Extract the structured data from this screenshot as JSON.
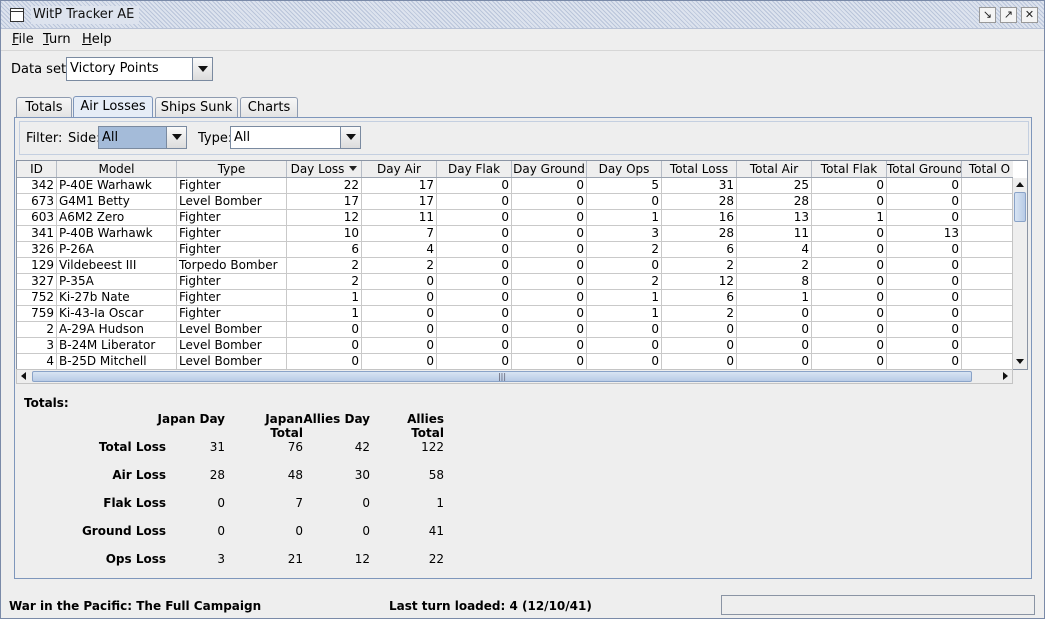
{
  "window": {
    "title": "WitP Tracker AE"
  },
  "menu": [
    {
      "label": "File",
      "mnemonic": "F",
      "rest": "ile"
    },
    {
      "label": "Turn",
      "mnemonic": "T",
      "rest": "urn"
    },
    {
      "label": "Help",
      "mnemonic": "H",
      "rest": "elp"
    }
  ],
  "dataset": {
    "label": "Data set:",
    "value": "Victory Points"
  },
  "tabs": [
    "Totals",
    "Air Losses",
    "Ships Sunk",
    "Charts"
  ],
  "active_tab": "Air Losses",
  "filter": {
    "label": "Filter:",
    "side_label": "Side:",
    "side_value": "All",
    "type_label": "Type:",
    "type_value": "All"
  },
  "table": {
    "columns": [
      "ID",
      "Model",
      "Type",
      "Day Loss",
      "Day Air",
      "Day Flak",
      "Day Ground",
      "Day Ops",
      "Total Loss",
      "Total Air",
      "Total Flak",
      "Total Ground",
      "Total O"
    ],
    "sorted_column": "Day Loss",
    "rows": [
      [
        "342",
        "P-40E Warhawk",
        "Fighter",
        "22",
        "17",
        "0",
        "0",
        "5",
        "31",
        "25",
        "0",
        "0",
        ""
      ],
      [
        "673",
        "G4M1 Betty",
        "Level Bomber",
        "17",
        "17",
        "0",
        "0",
        "0",
        "28",
        "28",
        "0",
        "0",
        ""
      ],
      [
        "603",
        "A6M2 Zero",
        "Fighter",
        "12",
        "11",
        "0",
        "0",
        "1",
        "16",
        "13",
        "1",
        "0",
        ""
      ],
      [
        "341",
        "P-40B Warhawk",
        "Fighter",
        "10",
        "7",
        "0",
        "0",
        "3",
        "28",
        "11",
        "0",
        "13",
        ""
      ],
      [
        "326",
        "P-26A",
        "Fighter",
        "6",
        "4",
        "0",
        "0",
        "2",
        "6",
        "4",
        "0",
        "0",
        ""
      ],
      [
        "129",
        "Vildebeest III",
        "Torpedo Bomber",
        "2",
        "2",
        "0",
        "0",
        "0",
        "2",
        "2",
        "0",
        "0",
        ""
      ],
      [
        "327",
        "P-35A",
        "Fighter",
        "2",
        "0",
        "0",
        "0",
        "2",
        "12",
        "8",
        "0",
        "0",
        ""
      ],
      [
        "752",
        "Ki-27b Nate",
        "Fighter",
        "1",
        "0",
        "0",
        "0",
        "1",
        "6",
        "1",
        "0",
        "0",
        ""
      ],
      [
        "759",
        "Ki-43-Ia Oscar",
        "Fighter",
        "1",
        "0",
        "0",
        "0",
        "1",
        "2",
        "0",
        "0",
        "0",
        ""
      ],
      [
        "2",
        "A-29A Hudson",
        "Level Bomber",
        "0",
        "0",
        "0",
        "0",
        "0",
        "0",
        "0",
        "0",
        "0",
        ""
      ],
      [
        "3",
        "B-24M Liberator",
        "Level Bomber",
        "0",
        "0",
        "0",
        "0",
        "0",
        "0",
        "0",
        "0",
        "0",
        ""
      ],
      [
        "4",
        "B-25D Mitchell",
        "Level Bomber",
        "0",
        "0",
        "0",
        "0",
        "0",
        "0",
        "0",
        "0",
        "0",
        ""
      ]
    ]
  },
  "totals": {
    "title": "Totals:",
    "columns": [
      "Japan Day",
      "Japan Total",
      "Allies Day",
      "Allies Total"
    ],
    "rows": [
      {
        "label": "Total Loss",
        "values": [
          "31",
          "76",
          "42",
          "122"
        ]
      },
      {
        "label": "Air Loss",
        "values": [
          "28",
          "48",
          "30",
          "58"
        ]
      },
      {
        "label": "Flak Loss",
        "values": [
          "0",
          "7",
          "0",
          "1"
        ]
      },
      {
        "label": "Ground Loss",
        "values": [
          "0",
          "0",
          "0",
          "41"
        ]
      },
      {
        "label": "Ops Loss",
        "values": [
          "3",
          "21",
          "12",
          "22"
        ]
      }
    ]
  },
  "status": {
    "campaign": "War in the Pacific: The Full Campaign",
    "last_turn": "Last turn loaded: 4 (12/10/41)"
  }
}
